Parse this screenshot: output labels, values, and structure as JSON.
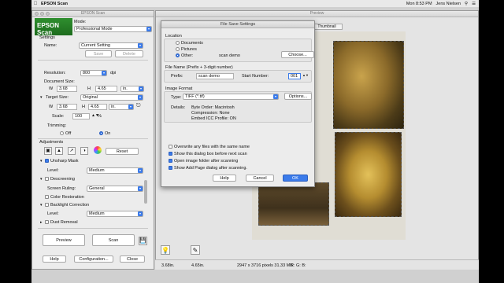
{
  "menubar": {
    "app_name": "EPSON Scan",
    "clock": "Mon 8:53 PM",
    "user": "Jens Nielsen"
  },
  "epson": {
    "window_title": "EPSON Scan",
    "logo_text": "EPSON Scan",
    "mode_label": "Mode:",
    "mode_value": "Professional Mode",
    "settings_heading": "Settings",
    "name_label": "Name:",
    "name_value": "Current Setting",
    "save_label": "Save",
    "delete_label": "Delete",
    "resolution_label": "Resolution:",
    "resolution_value": "800",
    "resolution_unit": "dpi",
    "doc_size_label": "Document Size:",
    "doc_w_label": "W",
    "doc_w_value": "3.68",
    "doc_h_label": "H",
    "doc_h_value": "4.65",
    "doc_unit": "in.",
    "target_size_label": "Target Size:",
    "target_size_value": "Original",
    "target_w_label": "W",
    "target_w_value": "3.68",
    "target_h_label": "H",
    "target_h_value": "4.65",
    "target_unit": "in.",
    "scale_label": "Scale:",
    "scale_value": "100",
    "scale_unit": "%",
    "trimming_label": "Trimming:",
    "trim_off": "Off",
    "trim_on": "On",
    "adjustments_heading": "Adjustments",
    "reset_label": "Reset",
    "unsharp_label": "Unsharp Mask",
    "unsharp_level_label": "Level:",
    "unsharp_level_value": "Medium",
    "descreening_label": "Descreening",
    "screen_ruling_label": "Screen Ruling:",
    "screen_ruling_value": "General",
    "color_restoration_label": "Color Restoration",
    "backlight_label": "Backlight Correction",
    "backlight_level_label": "Level:",
    "backlight_level_value": "Medium",
    "dust_label": "Dust Removal",
    "preview_label": "Preview",
    "scan_label": "Scan",
    "help_label": "Help",
    "configuration_label": "Configuration...",
    "close_label": "Close"
  },
  "preview": {
    "window_title": "Preview",
    "thumbnail_tab": "Thumbnail",
    "status_w": "3.68in.",
    "status_h": "4.65in.",
    "status_pixels": "2947 x 3716 pixels 31.33 MB",
    "status_rgb": "R: G: B:"
  },
  "dialog": {
    "title": "File Save Settings",
    "location_heading": "Location",
    "loc_documents": "Documents",
    "loc_pictures": "Pictures",
    "loc_other": "Other:",
    "loc_other_value": "scan demo",
    "choose_label": "Choose...",
    "filename_heading": "File Name (Prefix + 3-digit number)",
    "prefix_label": "Prefix:",
    "prefix_value": "scan demo",
    "start_number_label": "Start Number:",
    "start_number_value": "001",
    "image_format_heading": "Image Format",
    "type_label": "Type:",
    "type_value": "TIFF (*.tif)",
    "options_label": "Options...",
    "details_label": "Details:",
    "detail_1": "Byte Order: Macintosh",
    "detail_2": "Compression: None",
    "detail_3": "Embed ICC Profile: ON",
    "overwrite_label": "Overwrite any files with the same name",
    "show_dialog_label": "Show this dialog box before next scan",
    "open_folder_label": "Open image folder after scanning",
    "show_add_page_label": "Show Add Page dialog after scanning.",
    "help_label": "Help",
    "cancel_label": "Cancel",
    "ok_label": "OK"
  },
  "colors": {
    "accent": "#3b7bea",
    "epson_green": "#2f8f2f"
  }
}
